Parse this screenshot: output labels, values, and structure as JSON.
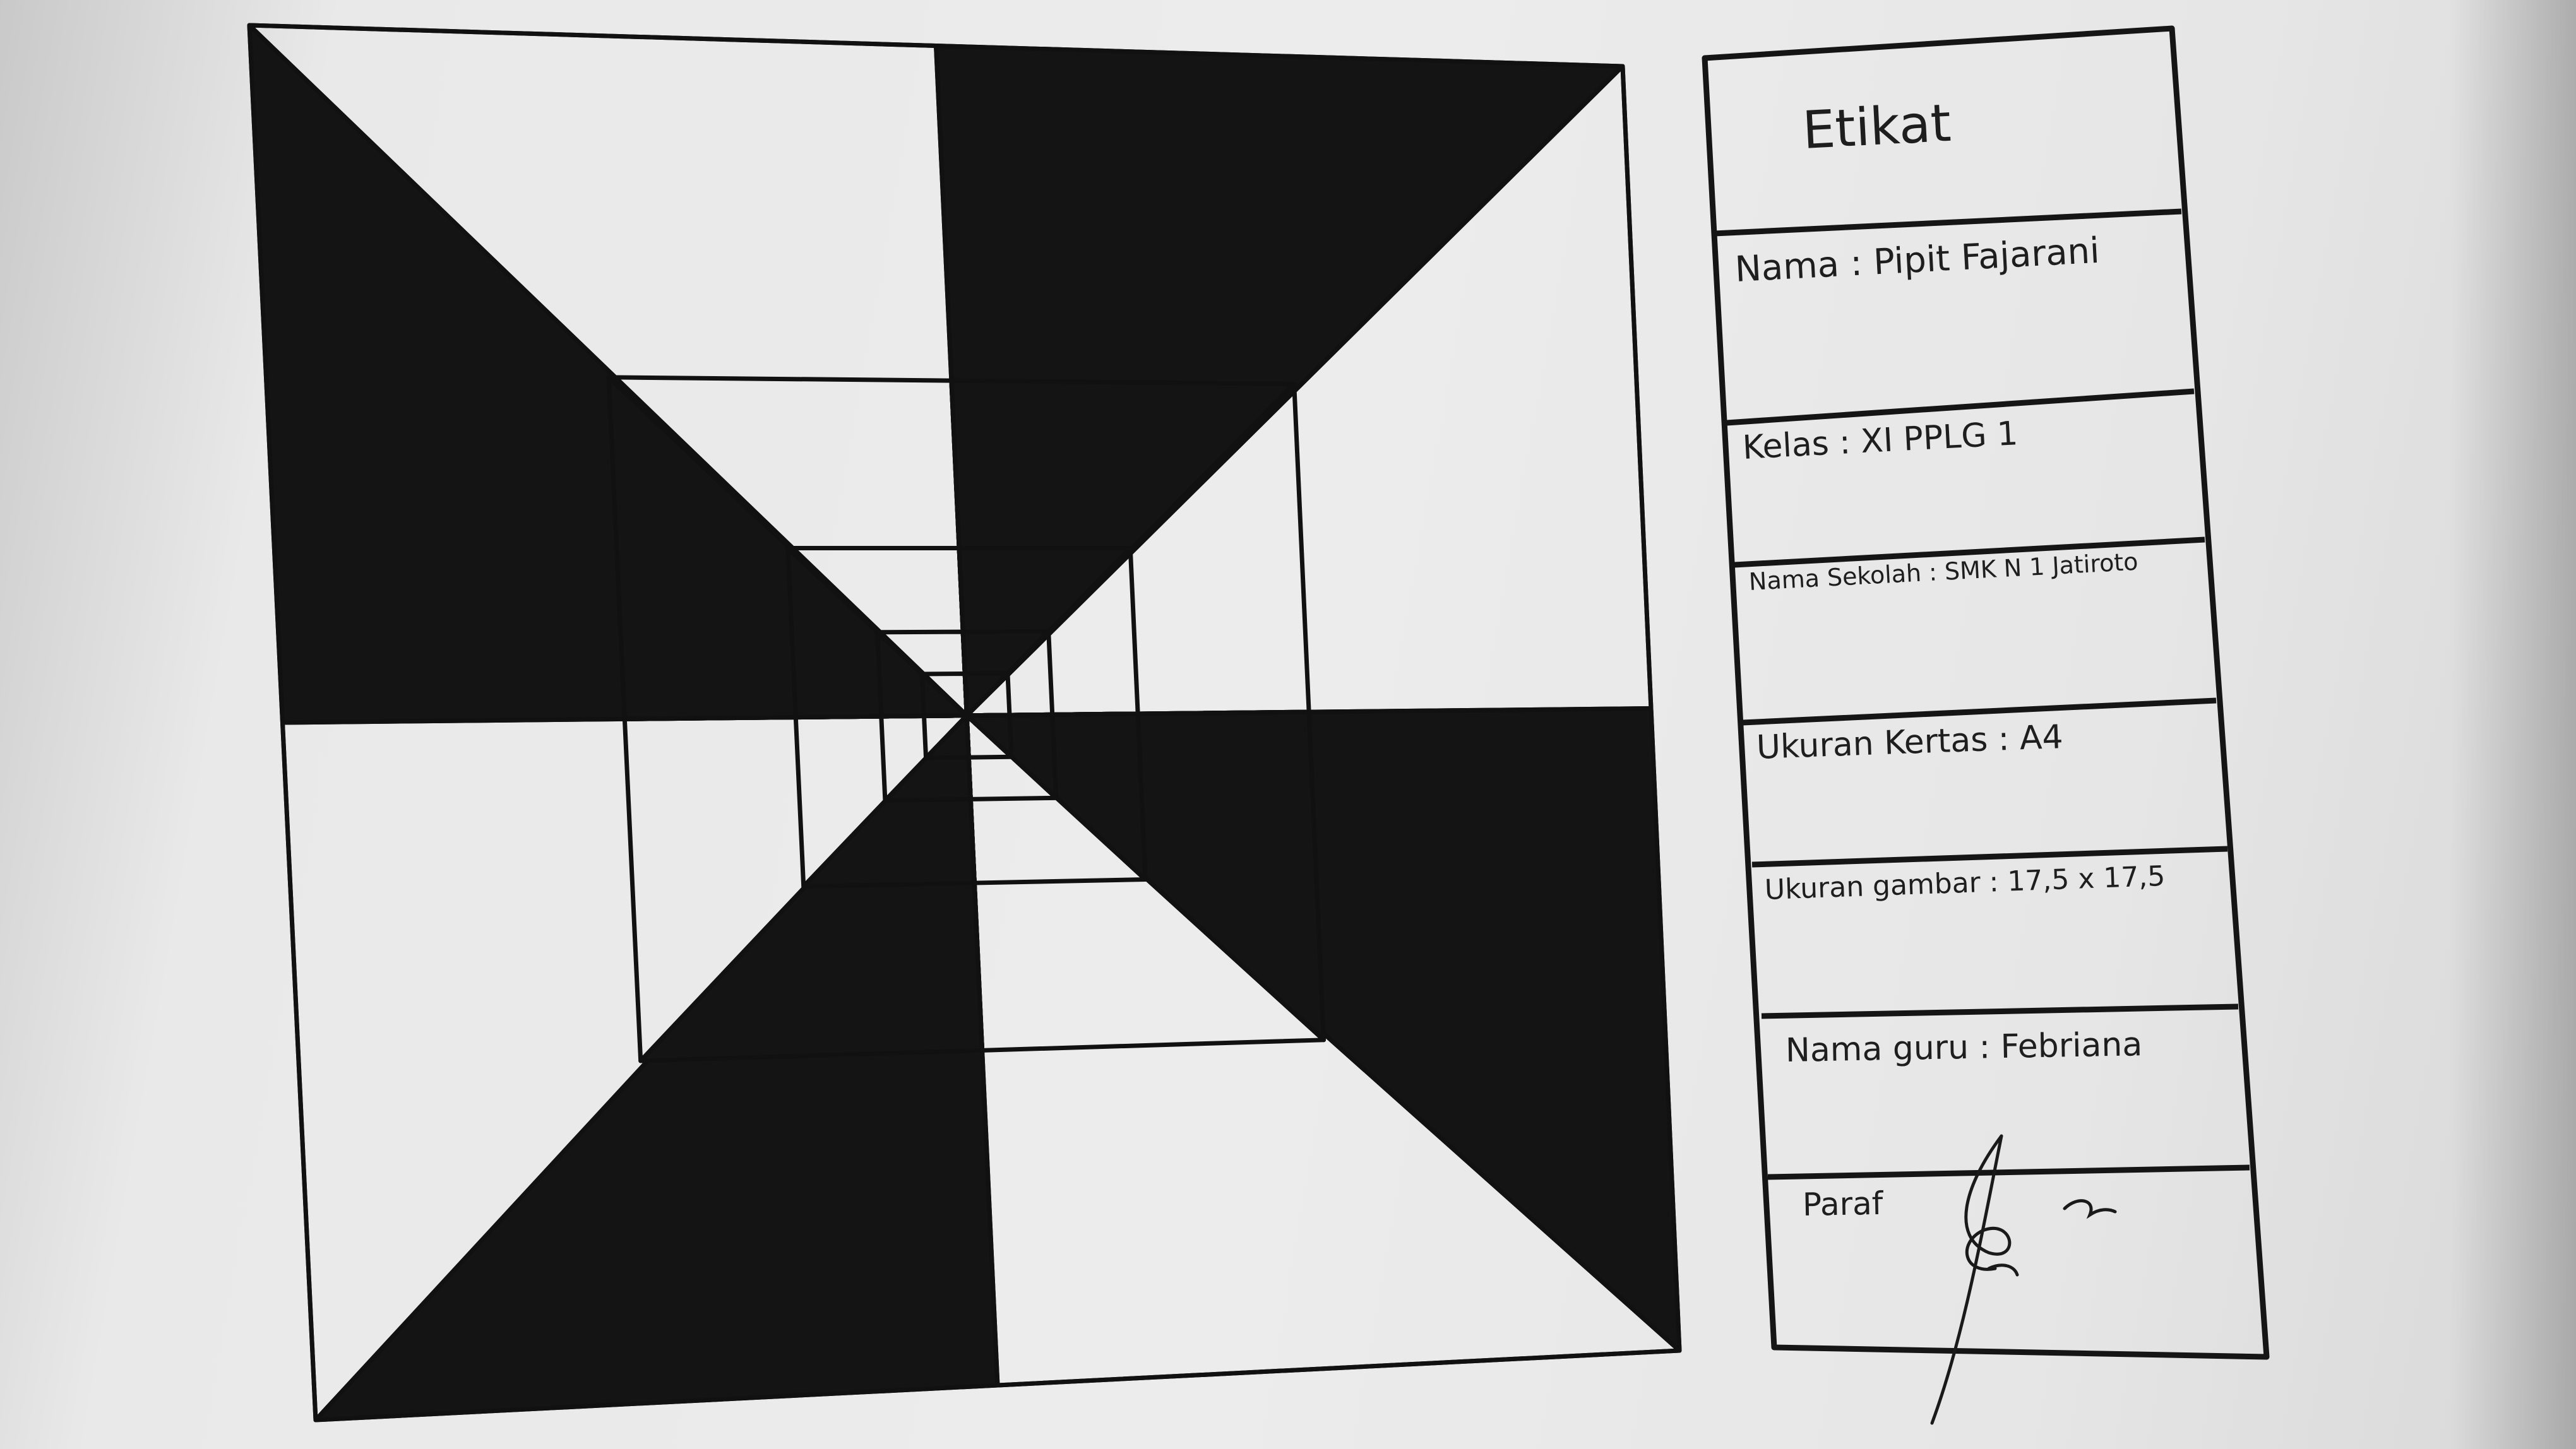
{
  "colors": {
    "ink": "#111111",
    "paper": "#ececec",
    "fill": "#141414"
  },
  "etiket": {
    "title": "Etikat",
    "nama": "Nama : Pipit Fajarani",
    "kelas": "Kelas : XI PPLG 1",
    "nama_sekolah": "Nama Sekolah : SMK N 1 Jatiroto",
    "ukuran_kertas": "Ukuran Kertas : A4",
    "ukuran_gambar": "Ukuran gambar : 17,5 x 17,5",
    "nama_guru": "Nama guru : Febriana",
    "paraf": "Paraf"
  }
}
